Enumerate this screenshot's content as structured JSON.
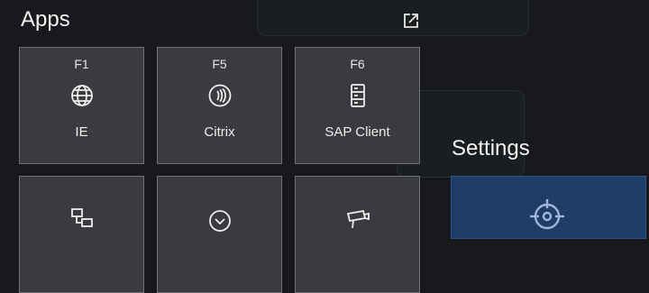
{
  "apps": {
    "title": "Apps",
    "tiles": [
      {
        "key": "F1",
        "label": "IE",
        "icon": "globe-icon"
      },
      {
        "key": "F5",
        "label": "Citrix",
        "icon": "citrix-icon"
      },
      {
        "key": "F6",
        "label": "SAP Client",
        "icon": "server-icon"
      },
      {
        "key": "",
        "label": "",
        "icon": "network-icon"
      },
      {
        "key": "",
        "label": "",
        "icon": "chevron-circle-icon"
      },
      {
        "key": "",
        "label": "",
        "icon": "camera-icon"
      }
    ]
  },
  "settings": {
    "title": "Settings",
    "tile_icon": "crosshair-icon"
  },
  "colors": {
    "background": "#17191c",
    "tile": "#3a3b3e",
    "tile_border": "#6f7174",
    "settings_tile": "#1f3d66"
  }
}
